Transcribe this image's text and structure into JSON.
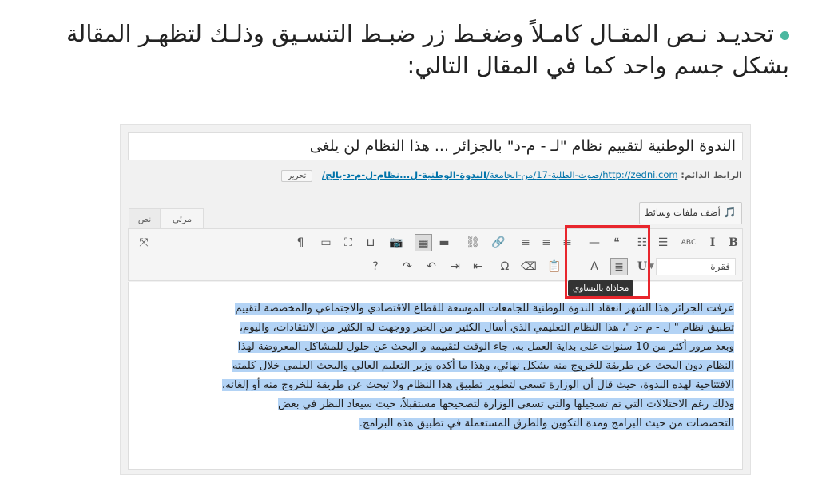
{
  "instruction": "تحديـد نـص المقـال كامـلاً وضغـط زر ضبـط التنسـيق وذلـك لتظهـر المقالة بشكل جسم واحد كما في المقال التالي:",
  "editor": {
    "post_title": "الندوة الوطنية لتقييم نظام \"لـ - م-د\" بالجزائر ... هذا النظام لن يلغى",
    "permalink_label": "الرابط الدائم:",
    "permalink_base": "http://zedni.com/صوت-الطلبة-17/من-الجامعة/",
    "permalink_slug": "الندوة-الوطنية-ل...نظام-ل-م-د-يالج/",
    "edit_button": "تحرير",
    "add_media_button": "أضف ملفات وسائط",
    "tabs": {
      "visual": "مرئي",
      "text": "نص"
    },
    "format_select": "فقرة",
    "tooltip": "محاذاة بالتساوي",
    "toolbar_row1": [
      {
        "name": "bold-button",
        "glyph": "B"
      },
      {
        "name": "italic-button",
        "glyph": "I"
      },
      {
        "name": "strikethrough-button",
        "glyph": "ABC"
      },
      {
        "name": "bullet-list-button",
        "glyph": "☰"
      },
      {
        "name": "numbered-list-button",
        "glyph": "☷"
      },
      {
        "name": "blockquote-button",
        "glyph": "❝"
      },
      {
        "name": "horizontal-line-button",
        "glyph": "—"
      },
      {
        "name": "align-left-button",
        "glyph": "≡"
      },
      {
        "name": "align-center-button",
        "glyph": "≡"
      },
      {
        "name": "align-right-button",
        "glyph": "≡"
      },
      {
        "name": "insert-link-button",
        "glyph": "🔗"
      },
      {
        "name": "remove-link-button",
        "glyph": "⛓"
      },
      {
        "name": "read-more-button",
        "glyph": "▬"
      },
      {
        "name": "toolbar-toggle-button",
        "glyph": "▦"
      },
      {
        "name": "insert-image-button",
        "glyph": "📷"
      },
      {
        "name": "distraction-free-button",
        "glyph": "⊔"
      },
      {
        "name": "fullscreen-button",
        "glyph": "⛶"
      },
      {
        "name": "page-break-button",
        "glyph": "▭"
      },
      {
        "name": "paragraph-button",
        "glyph": "¶"
      }
    ],
    "toolbar_row2": [
      {
        "name": "underline-button",
        "glyph": "U"
      },
      {
        "name": "justify-button",
        "glyph": "≣"
      },
      {
        "name": "text-color-button",
        "glyph": "A"
      },
      {
        "name": "paste-as-text-button",
        "glyph": "📋"
      },
      {
        "name": "clear-formatting-button",
        "glyph": "⌫"
      },
      {
        "name": "special-character-button",
        "glyph": "Ω"
      },
      {
        "name": "outdent-button",
        "glyph": "⇤"
      },
      {
        "name": "indent-button",
        "glyph": "⇥"
      },
      {
        "name": "undo-button",
        "glyph": "↶"
      },
      {
        "name": "redo-button",
        "glyph": "↷"
      },
      {
        "name": "help-button",
        "glyph": "?"
      }
    ],
    "body_lines": [
      "عرفت الجزائر هذا الشهر انعقاد الندوة الوطنية للجامعات الموسعة للقطاع الاقتصادي والاجتماعي والمخصصة لتقييم",
      "تطبيق نظام \" ل - م -د \"، هذا النظام التعليمي الذي أسال الكثير من الحبر ووجهت له الكثير من الانتقادات، واليوم،",
      "وبعد مرور أكثر من 10 سنوات على بداية العمل به، جاء الوقت لتقييمه و البحث عن حلول للمشاكل المعروضة لهذا",
      "النظام دون البحث عن طريقة للخروج منه بشكل نهائي، وهذا ما أكده وزير التعليم العالي والبحث العلمي خلال كلمته",
      "الافتتاحية لهذه الندوة، حيث قال أن الوزارة تسعى لتطوير تطبيق هذا النظام ولا تبحث عن طريقة للخروج منه أو إلغائه،",
      "وذلك رغم الاختلالات التي تم تسجيلها والتي تسعى الوزارة لتصحيحها مستقبلاً، حيث سيعاد النظر في بعض",
      "التخصصات من حيث البرامج ومدة التكوين والطرق المستعملة في تطبيق هذه البرامج."
    ]
  }
}
